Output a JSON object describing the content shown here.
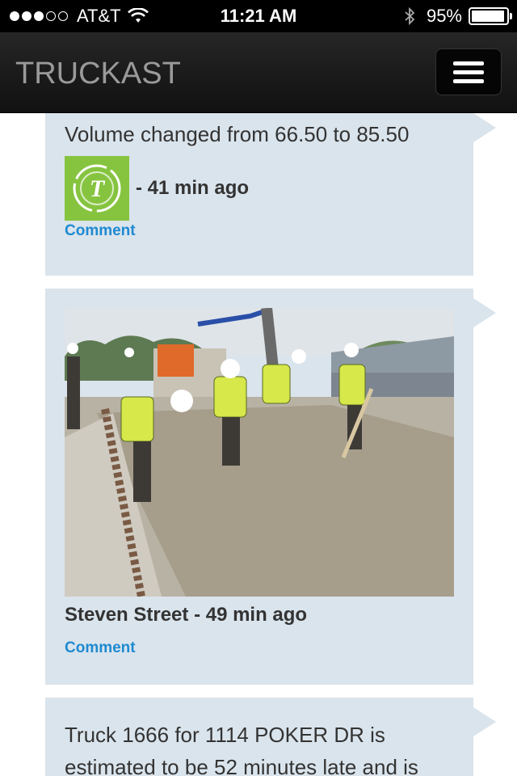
{
  "status_bar": {
    "carrier": "AT&T",
    "time": "11:21 AM",
    "battery": "95%",
    "signal_bars_filled": 3,
    "signal_bars_total": 5
  },
  "navbar": {
    "brand": "TRUCKAST",
    "menu_icon": "hamburger-menu-icon"
  },
  "feed": {
    "items": [
      {
        "message": "Volume changed from 66.50 to 85.50",
        "avatar_letter": "T",
        "time_ago": "- 41 min ago",
        "comment_label": "Comment"
      },
      {
        "author_line": "Steven Street - 49 min ago",
        "comment_label": "Comment"
      },
      {
        "message": "Truck 1666 for 1114 POKER DR is estimated to be 52 minutes late and is"
      }
    ]
  },
  "colors": {
    "card_bg": "#dae4ec",
    "link": "#1f8ad1",
    "avatar_green": "#86c440",
    "navbar_bg": "#1a1a1a"
  }
}
